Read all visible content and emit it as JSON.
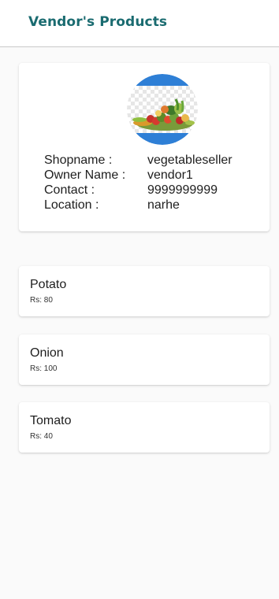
{
  "header": {
    "title": "Vendor's Products"
  },
  "vendor": {
    "shopname_label": "Shopname :",
    "shopname": "vegetableseller",
    "owner_label": "Owner Name :",
    "owner": "vendor1",
    "contact_label": "Contact :",
    "contact": "9999999999",
    "location_label": "Location :",
    "location": "narhe"
  },
  "products": [
    {
      "name": "Potato",
      "price": "Rs: 80"
    },
    {
      "name": "Onion",
      "price": "Rs: 100"
    },
    {
      "name": "Tomato",
      "price": "Rs: 40"
    }
  ],
  "colors": {
    "title": "#1a6b70",
    "avatar_band": "#2e7fd6"
  }
}
